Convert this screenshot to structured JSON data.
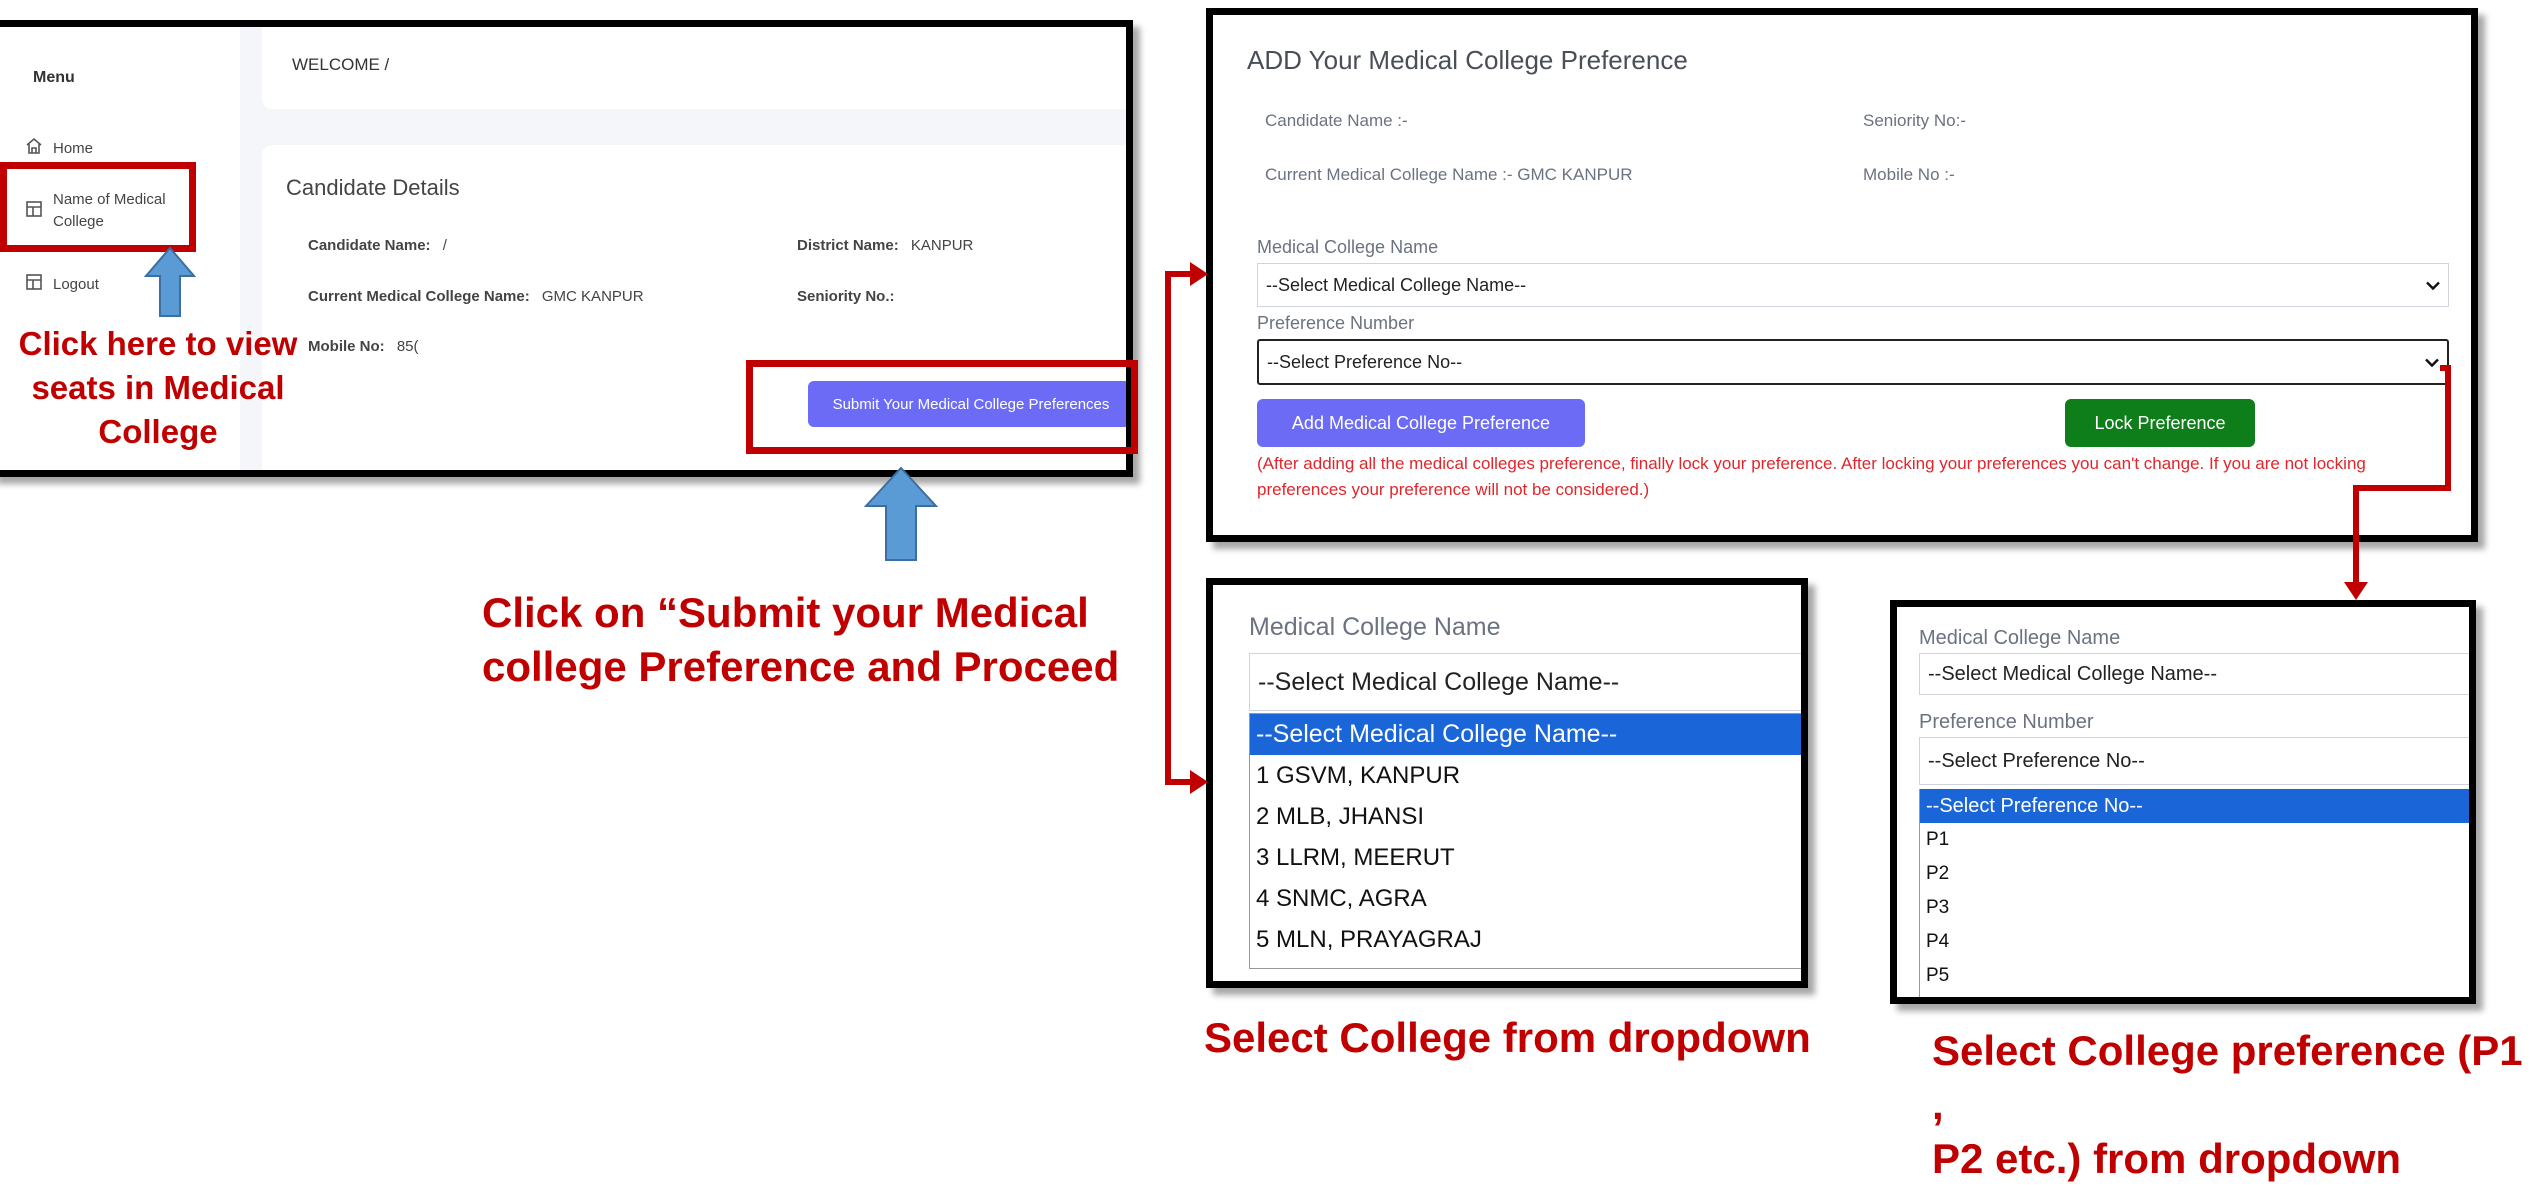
{
  "colors": {
    "red": "#c00000",
    "blue_arrow": "#5b9bd5",
    "btn_purple": "#6b6bf5",
    "btn_green": "#0e7e1a",
    "highlight": "#1a66d8"
  },
  "left_panel": {
    "menu_title": "Menu",
    "home": "Home",
    "medical_college_line1": "Name of Medical",
    "medical_college_line2": "College",
    "logout": "Logout",
    "welcome": "WELCOME /",
    "candidate_details_title": "Candidate Details",
    "candidate_name_label": "Candidate Name:",
    "candidate_name_value": "/",
    "district_label": "District Name:",
    "district_value": "KANPUR",
    "current_college_label": "Current Medical College Name:",
    "current_college_value": "GMC KANPUR",
    "seniority_label": "Seniority No.:",
    "mobile_label": "Mobile No:",
    "mobile_value": "85(",
    "submit_button": "Submit Your Medical College Preferences"
  },
  "annotations": {
    "view_seats_line1": "Click here to view",
    "view_seats_line2": "seats in Medical",
    "view_seats_line3": "College",
    "submit_line1": "Click on “Submit your Medical",
    "submit_line2": "college Preference and Proceed",
    "select_college": "Select College from dropdown",
    "select_pref_line1": "Select College preference (P1 ,",
    "select_pref_line2": "P2 etc.) from dropdown"
  },
  "add_form": {
    "title": "ADD Your Medical College Preference",
    "candidate_name": "Candidate Name :-",
    "seniority": "Seniority No:-",
    "current_college": "Current Medical College Name :- GMC KANPUR",
    "mobile": "Mobile No :-",
    "college_label": "Medical College Name",
    "college_placeholder": "--Select Medical College Name--",
    "pref_label": "Preference Number",
    "pref_placeholder": "--Select Preference No--",
    "add_button": "Add Medical College Preference",
    "lock_button": "Lock Preference",
    "warning": "(After adding all the medical colleges preference, finally lock your preference. After locking your preferences you can't change. If you are not locking preferences your preference will not be considered.)"
  },
  "college_dropdown": {
    "label": "Medical College Name",
    "selected": "--Select Medical College Name--",
    "options": [
      "--Select Medical College Name--",
      "1 GSVM, KANPUR",
      "2 MLB, JHANSI",
      "3 LLRM, MEERUT",
      "4 SNMC, AGRA",
      "5 MLN, PRAYAGRAJ"
    ]
  },
  "pref_dropdown": {
    "college_label": "Medical College Name",
    "college_selected": "--Select Medical College Name--",
    "label": "Preference Number",
    "selected": "--Select Preference No--",
    "options": [
      "--Select Preference No--",
      "P1",
      "P2",
      "P3",
      "P4",
      "P5"
    ]
  }
}
